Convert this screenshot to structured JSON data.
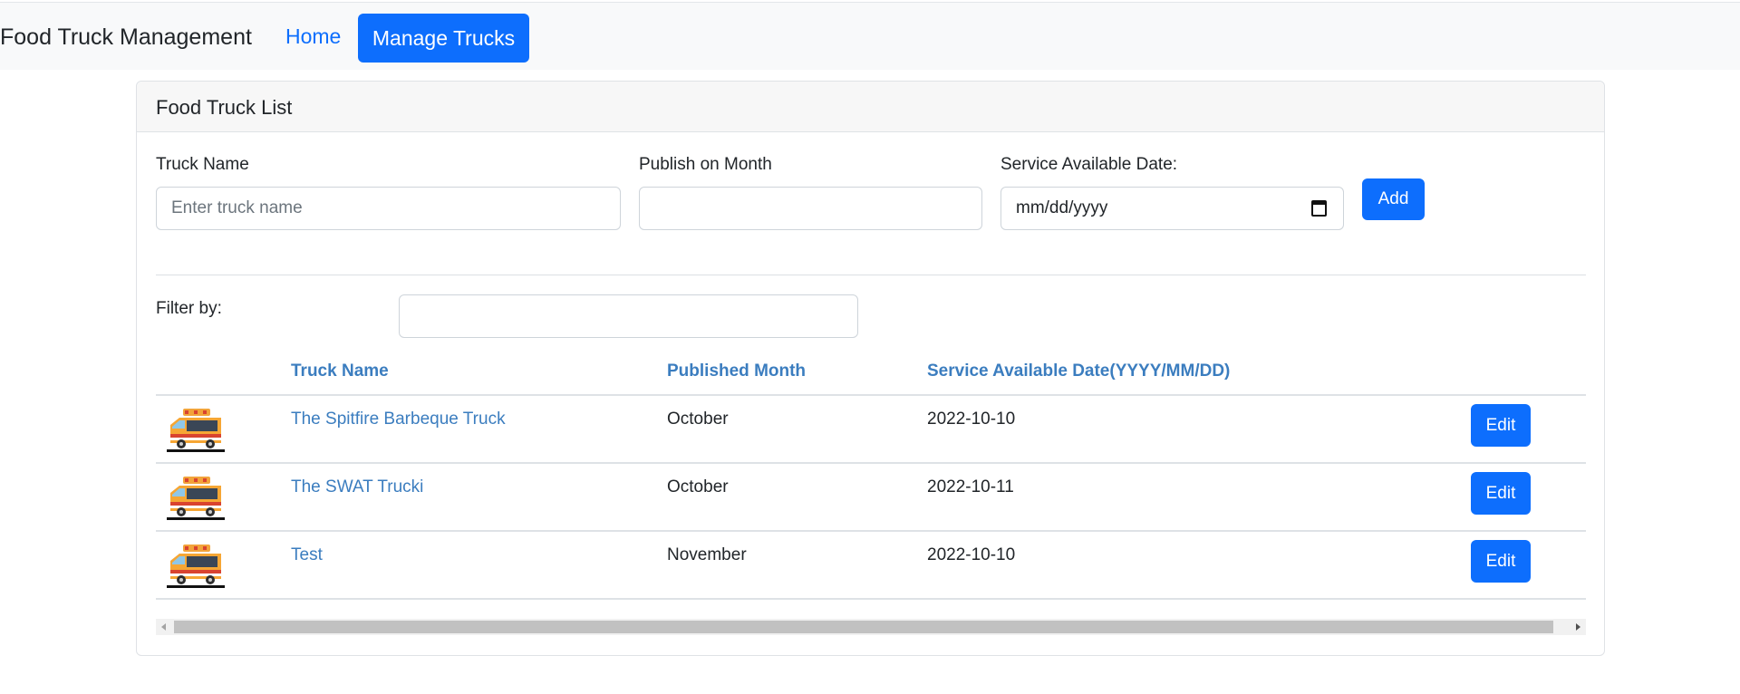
{
  "nav": {
    "brand": "Food Truck Management",
    "home": "Home",
    "manage": "Manage Trucks"
  },
  "card": {
    "title": "Food Truck List"
  },
  "form": {
    "truck_name_label": "Truck Name",
    "truck_name_placeholder": "Enter truck name",
    "truck_name_value": "",
    "month_label": "Publish on Month",
    "month_value": "",
    "date_label": "Service Available Date:",
    "date_value": "mm/dd/yyyy",
    "add_label": "Add"
  },
  "filter": {
    "label": "Filter by:",
    "value": ""
  },
  "table": {
    "headers": [
      "",
      "Truck Name",
      "Published Month",
      "Service Available Date(YYYY/MM/DD)",
      ""
    ],
    "rows": [
      {
        "name": "The Spitfire Barbeque Truck",
        "month": "October",
        "date": "2022-10-10",
        "action": "Edit"
      },
      {
        "name": "The SWAT Trucki",
        "month": "October",
        "date": "2022-10-11",
        "action": "Edit"
      },
      {
        "name": "Test",
        "month": "November",
        "date": "2022-10-10",
        "action": "Edit"
      }
    ]
  },
  "colors": {
    "primary": "#0d6efd",
    "link": "#3b7dbf",
    "navbar_bg": "#f8f9fa"
  },
  "icons": {
    "row_image": "food-truck-icon",
    "date_picker": "calendar-icon",
    "scroll_left": "scroll-left-arrow-icon",
    "scroll_right": "scroll-right-arrow-icon"
  }
}
